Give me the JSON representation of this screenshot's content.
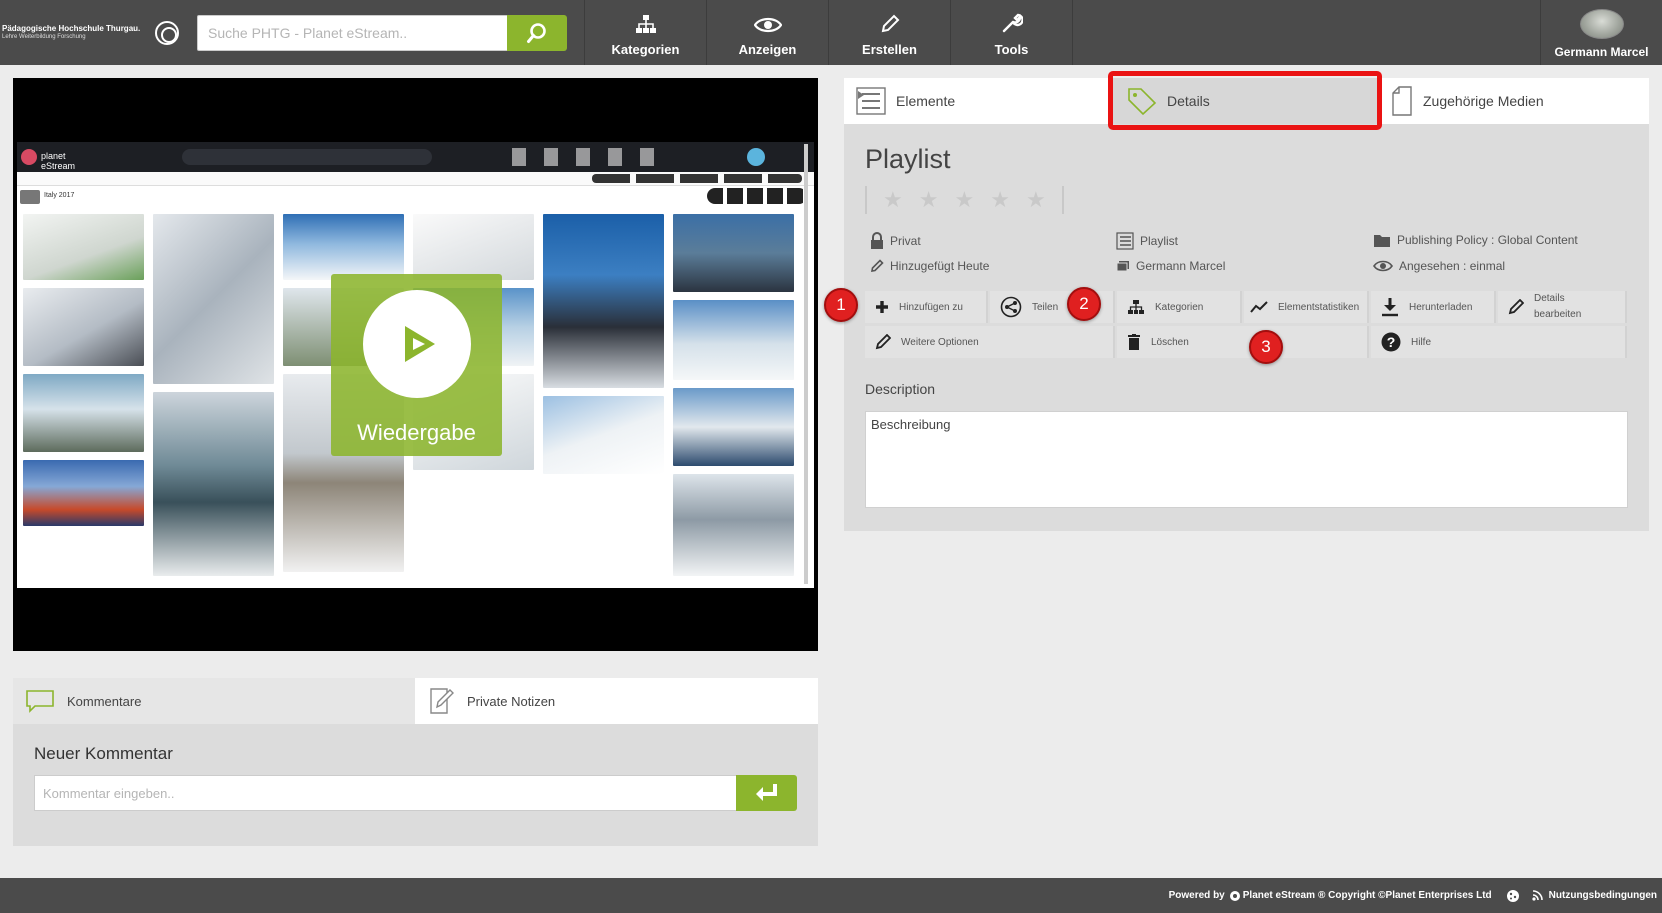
{
  "header": {
    "logo_title": "Pädagogische Hochschule Thurgau.",
    "logo_subtitle": "Lehre Weiterbildung Forschung",
    "search_placeholder": "Suche PHTG - Planet eStream..",
    "nav": [
      {
        "label": "Kategorien",
        "icon": "sitemap-icon"
      },
      {
        "label": "Anzeigen",
        "icon": "eye-icon"
      },
      {
        "label": "Erstellen",
        "icon": "pencil-icon"
      },
      {
        "label": "Tools",
        "icon": "wrench-icon"
      }
    ],
    "user_name": "Germann Marcel"
  },
  "video": {
    "play_label": "Wiedergabe",
    "preview_collection_title": "Italy 2017"
  },
  "comments": {
    "tabs": [
      {
        "label": "Kommentare",
        "icon": "speech-bubble-icon"
      },
      {
        "label": "Private Notizen",
        "icon": "note-edit-icon"
      }
    ],
    "new_comment_label": "Neuer Kommentar",
    "input_placeholder": "Kommentar eingeben.."
  },
  "details": {
    "tabs": [
      {
        "label": "Elemente",
        "icon": "list-icon"
      },
      {
        "label": "Details",
        "icon": "tag-icon"
      },
      {
        "label": "Zugehörige Medien",
        "icon": "file-icon"
      }
    ],
    "title": "Playlist",
    "rating_stars": 5,
    "rating_value": 0,
    "meta": [
      {
        "text": "Privat",
        "icon": "lock-icon"
      },
      {
        "text": "Playlist",
        "icon": "list-icon"
      },
      {
        "text": "Publishing Policy : Global Content",
        "icon": "folder-icon"
      },
      {
        "text": "Hinzugefügt Heute",
        "icon": "pencil-icon"
      },
      {
        "text": "Germann Marcel",
        "icon": "person-card-icon"
      },
      {
        "text": "Angesehen : einmal",
        "icon": "eye-icon"
      }
    ],
    "actions": {
      "add": "Hinzufügen zu",
      "share": "Teilen",
      "categories": "Kategorien",
      "stats": "Elementstatistiken",
      "download": "Herunterladen",
      "edit_details_1": "Details",
      "edit_details_2": "bearbeiten",
      "more": "Weitere Optionen",
      "delete": "Löschen",
      "help": "Hilfe"
    },
    "badges": [
      "1",
      "2",
      "3"
    ],
    "description_label": "Description",
    "description_text": "Beschreibung"
  },
  "footer": {
    "powered_by": "Powered by",
    "brand": "Planet eStream",
    "copyright": "® Copyright ©Planet Enterprises Ltd",
    "terms": "Nutzungsbedingungen"
  },
  "colors": {
    "accent_green": "#8cb52d",
    "header_bg": "#4b4b4b",
    "highlight_red": "#ea1313"
  }
}
